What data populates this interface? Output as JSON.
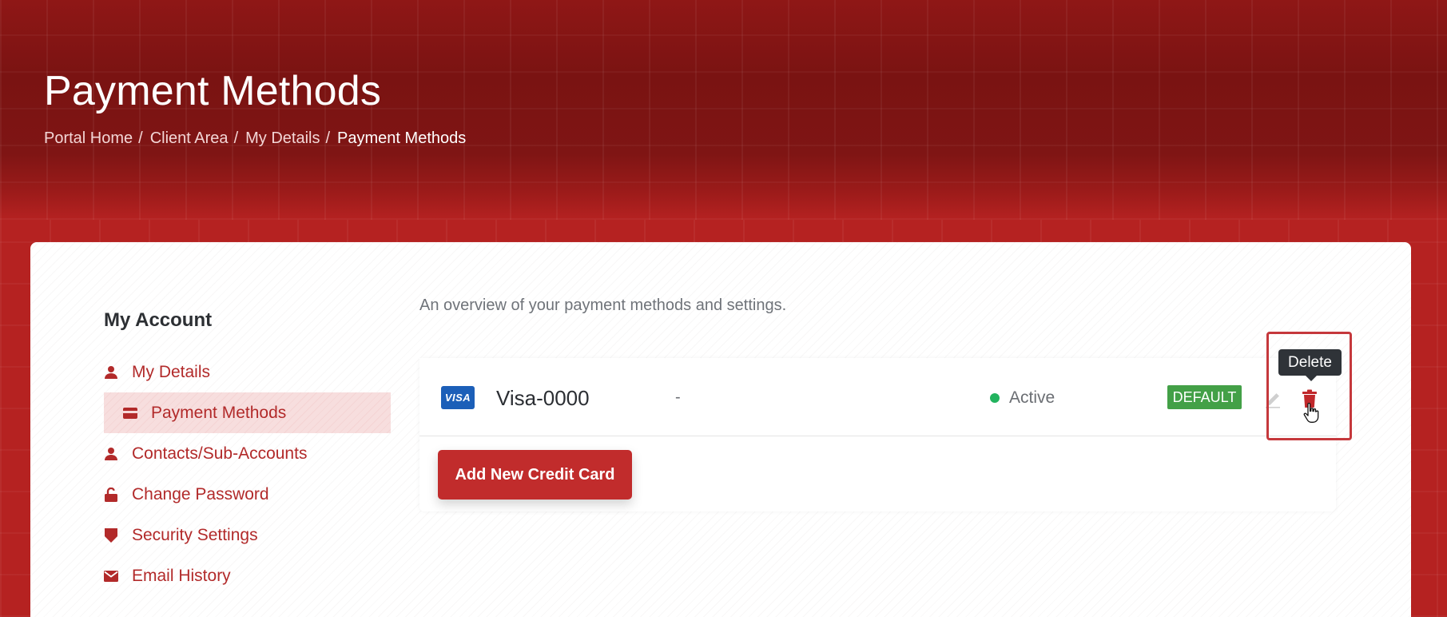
{
  "header": {
    "title": "Payment Methods",
    "breadcrumb": [
      {
        "label": "Portal Home"
      },
      {
        "label": "Client Area"
      },
      {
        "label": "My Details"
      },
      {
        "label": "Payment Methods"
      }
    ]
  },
  "sidebar": {
    "title": "My Account",
    "items": [
      {
        "label": "My Details",
        "icon": "user-icon"
      },
      {
        "label": "Payment Methods",
        "icon": "credit-card-icon",
        "active": true
      },
      {
        "label": "Contacts/Sub-Accounts",
        "icon": "user-icon"
      },
      {
        "label": "Change Password",
        "icon": "unlock-icon"
      },
      {
        "label": "Security Settings",
        "icon": "shield-icon"
      },
      {
        "label": "Email History",
        "icon": "envelope-icon"
      }
    ]
  },
  "main": {
    "overview": "An overview of your payment methods and settings.",
    "payment_method": {
      "brand": "VISA",
      "name": "Visa-0000",
      "description": "-",
      "status": "Active",
      "default_label": "DEFAULT"
    },
    "tooltip": "Delete",
    "add_button": "Add New Credit Card"
  },
  "colors": {
    "brand": "#b3201f",
    "primary_button": "#c12c2c",
    "status_active": "#22b35e",
    "default_badge": "#43a047",
    "visa": "#1c5fb8",
    "sidebar_link": "#b22a2a"
  }
}
